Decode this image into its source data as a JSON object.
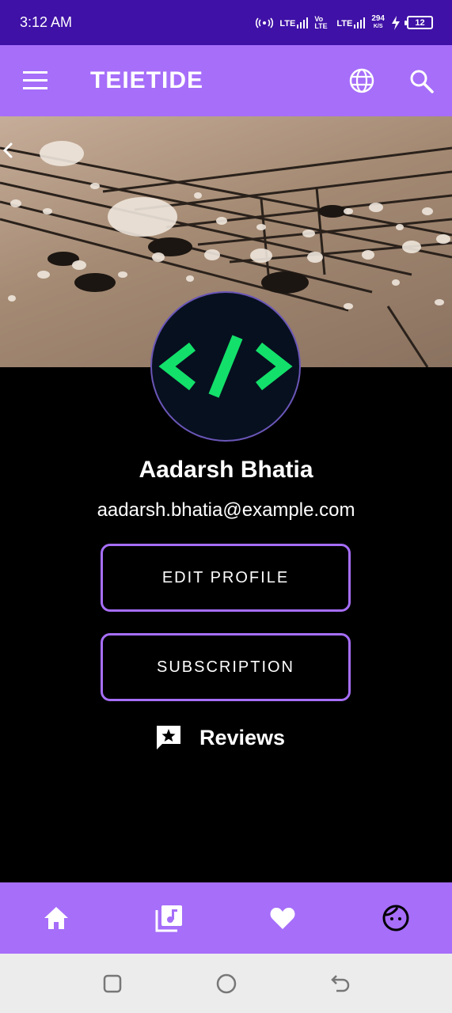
{
  "status_bar": {
    "time": "3:12 AM",
    "net1": "LTE",
    "net2": "Vo LTE",
    "net3": "LTE",
    "speed": "294",
    "speed_unit": "K/S",
    "battery": "12"
  },
  "app_bar": {
    "title": "TEIETIDE",
    "icons": [
      "menu-icon",
      "globe-icon",
      "search-icon"
    ]
  },
  "profile": {
    "name": "Aadarsh Bhatia",
    "email": "aadarsh.bhatia@example.com",
    "avatar_icon": "code-icon",
    "edit_label": "EDIT PROFILE",
    "subscription_label": "SUBSCRIPTION",
    "reviews_label": "Reviews"
  },
  "bottom_nav": {
    "items": [
      "home-icon",
      "music-library-icon",
      "heart-icon",
      "face-icon"
    ]
  },
  "colors": {
    "status_bar": "#3f11a6",
    "accent": "#a66ef9",
    "avatar_code": "#13e06a",
    "background": "#000000"
  }
}
